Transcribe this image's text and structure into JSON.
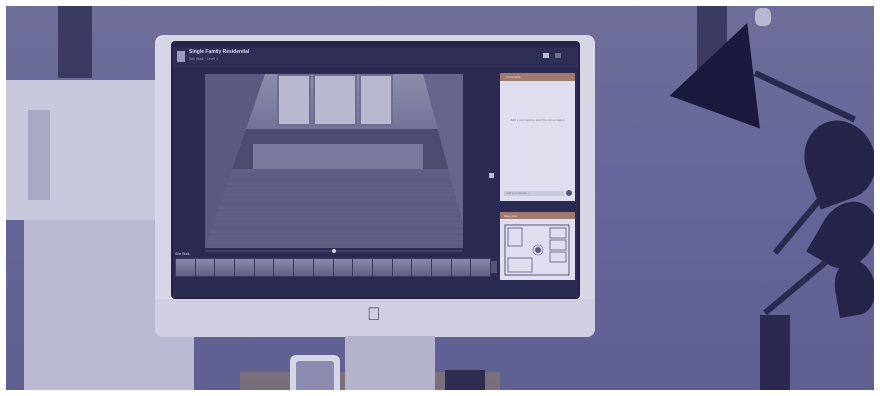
{
  "app": {
    "title": "Single Family Residential",
    "subtitle": "Site Walk · Level 1"
  },
  "viewer": {
    "next_label": "›"
  },
  "sidebar": {
    "tab_active": "Comments",
    "empty_message": "Add a comment to start the conversation",
    "input_placeholder": "Add a comment..."
  },
  "minimap": {
    "header": "Floor plan"
  },
  "filmstrip": {
    "label": "Site Walk",
    "thumb_count": 16
  },
  "colors": {
    "overlay": "#66669a",
    "accent": "#a07a6e"
  },
  "icons": [
    "apple-logo-icon",
    "app-logo-icon",
    "next-arrow-icon",
    "send-icon"
  ]
}
